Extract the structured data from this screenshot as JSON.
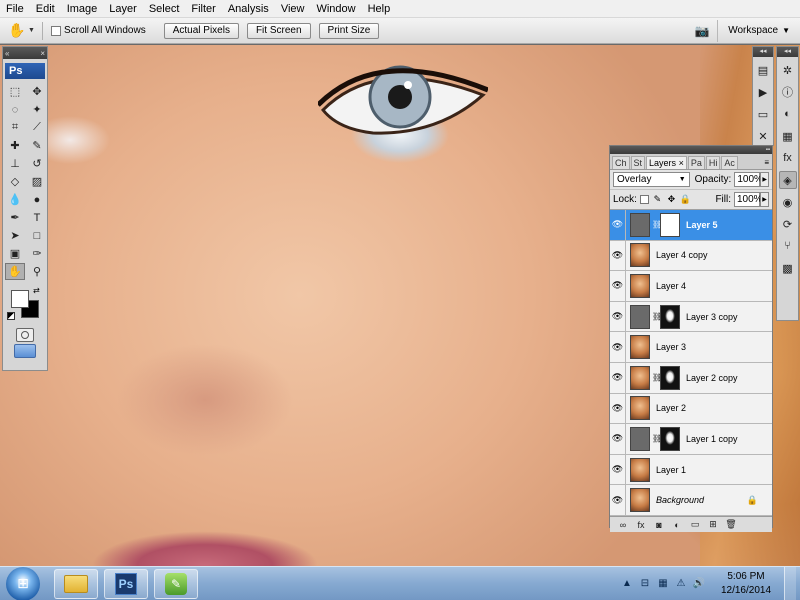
{
  "menu": [
    "File",
    "Edit",
    "Image",
    "Layer",
    "Select",
    "Filter",
    "Analysis",
    "View",
    "Window",
    "Help"
  ],
  "options": {
    "scroll_all_label": "Scroll All Windows",
    "actual_pixels_label": "Actual Pixels",
    "fit_screen_label": "Fit Screen",
    "print_size_label": "Print Size",
    "workspace_label": "Workspace"
  },
  "tools": {
    "logo_text": "Ps"
  },
  "layers_panel": {
    "tabs": [
      "Ch",
      "St",
      "Layers",
      "Pa",
      "Hi",
      "Ac"
    ],
    "active_tab": "Layers",
    "blend_mode": "Overlay",
    "opacity_label": "Opacity:",
    "opacity_value": "100%",
    "lock_label": "Lock:",
    "fill_label": "Fill:",
    "fill_value": "100%",
    "layers": [
      {
        "name": "Layer 5",
        "thumb": "gray",
        "mask": "white",
        "selected": true
      },
      {
        "name": "Layer 4 copy",
        "thumb": "photo",
        "mask": null,
        "selected": false
      },
      {
        "name": "Layer 4",
        "thumb": "photo",
        "mask": null,
        "selected": false
      },
      {
        "name": "Layer 3 copy",
        "thumb": "gray",
        "mask": "portrait",
        "selected": false
      },
      {
        "name": "Layer 3",
        "thumb": "photo",
        "mask": null,
        "selected": false
      },
      {
        "name": "Layer 2 copy",
        "thumb": "photo",
        "mask": "portrait",
        "selected": false
      },
      {
        "name": "Layer 2",
        "thumb": "photo",
        "mask": null,
        "selected": false
      },
      {
        "name": "Layer 1 copy",
        "thumb": "gray",
        "mask": "portrait",
        "selected": false
      },
      {
        "name": "Layer 1",
        "thumb": "photo",
        "mask": null,
        "selected": false
      },
      {
        "name": "Background",
        "thumb": "photo",
        "mask": null,
        "selected": false,
        "locked": true
      }
    ]
  },
  "taskbar": {
    "time": "5:06 PM",
    "date": "12/16/2014",
    "ps_label": "Ps"
  }
}
